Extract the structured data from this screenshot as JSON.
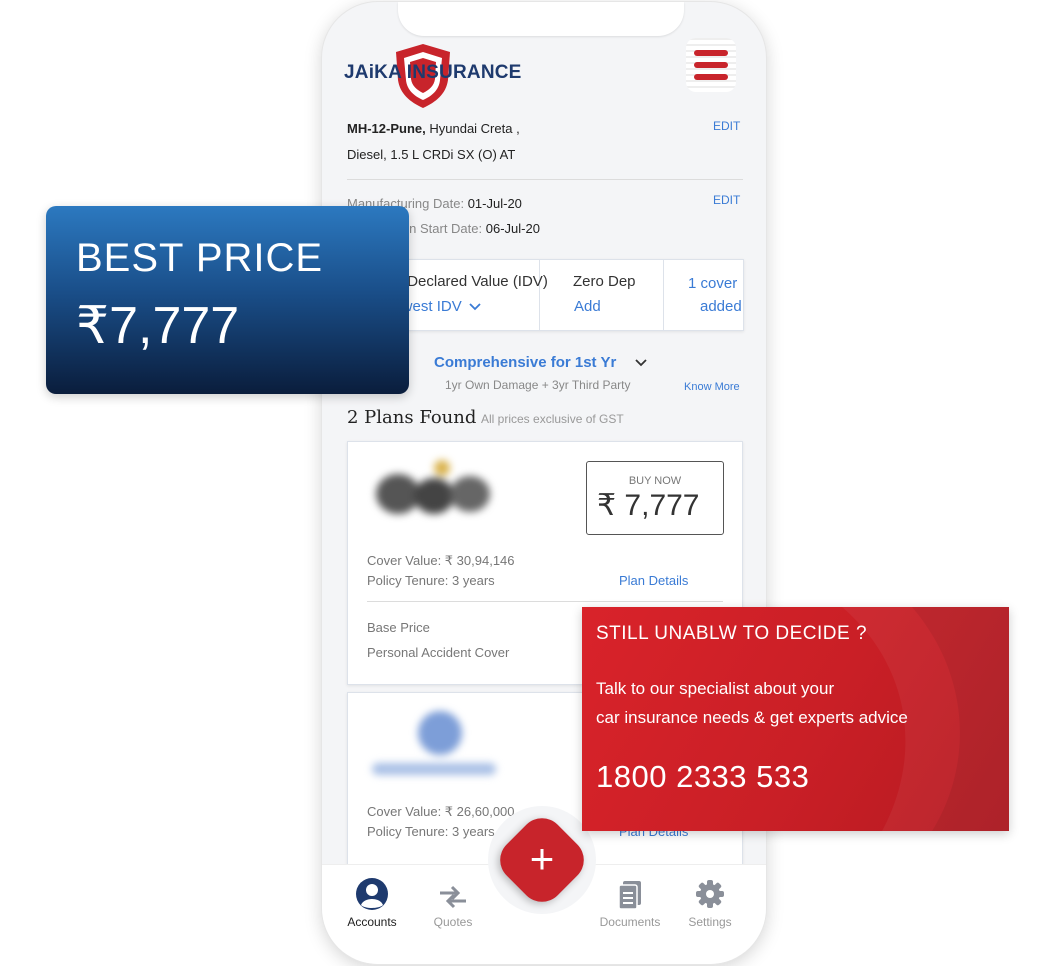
{
  "brand": {
    "name": "JAiKA INSURANCE"
  },
  "vehicle": {
    "registration": "MH-12-Pune,",
    "model": "Hyundai Creta ,",
    "variant": "Diesel, 1.5 L CRDi SX (O) AT",
    "edit_label_1": "EDIT",
    "edit_label_2": "EDIT",
    "manufacturing_label": "Manufacturing Date:",
    "manufacturing_date": "01-Jul-20",
    "registration_label": "Registration Start Date:",
    "registration_date": "06-Jul-20"
  },
  "options": {
    "idv_title": "Insured Declared Value (IDV)",
    "idv_value": "Lowest IDV",
    "zero_dep_title": "Zero Dep",
    "zero_dep_value": "Add",
    "cover_line1": "1 cover",
    "cover_line2": "added"
  },
  "plan_type": {
    "label": "Comprehensive for 1st Yr",
    "subtitle": "1yr Own Damage + 3yr Third Party",
    "know_more": "Know More"
  },
  "results": {
    "heading": "2 Plans Found",
    "note": "All prices exclusive of GST"
  },
  "plans": [
    {
      "buy_label": "BUY NOW",
      "price": "₹ 7,777",
      "cover_value": "Cover Value: ₹ 30,94,146",
      "tenure": "Policy Tenure: 3 years",
      "details_link": "Plan Details",
      "base_price_label": "Base Price",
      "pa_cover_label": "Personal Accident Cover"
    },
    {
      "cover_value": "Cover Value: ₹ 26,60,000",
      "tenure": "Policy Tenure: 3 years",
      "details_link": "Plan Details"
    }
  ],
  "nav": {
    "accounts": "Accounts",
    "quotes": "Quotes",
    "documents": "Documents",
    "settings": "Settings",
    "fab_symbol": "+"
  },
  "best_price": {
    "title": "BEST PRICE",
    "amount": "₹7,777"
  },
  "decide": {
    "heading": "STILL UNABLW TO DECIDE ?",
    "line1": "Talk to our specialist about your",
    "line2": "car insurance needs & get experts advice",
    "phone": "1800 2333 533"
  },
  "colors": {
    "accent_blue": "#3a7bd5",
    "brand_red": "#c8242b",
    "brand_navy": "#1e3a6e"
  }
}
